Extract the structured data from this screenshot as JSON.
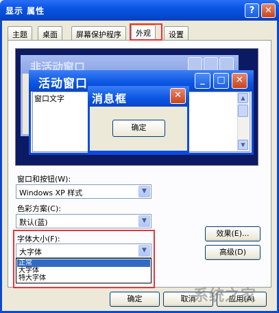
{
  "window": {
    "title": "显示 属性",
    "help_label": "?",
    "close_label": "✕"
  },
  "tabs": [
    {
      "label": "主题"
    },
    {
      "label": "桌面"
    },
    {
      "label": "屏幕保护程序"
    },
    {
      "label": "外观",
      "active": true
    },
    {
      "label": "设置"
    }
  ],
  "preview": {
    "inactive_title": "非活动窗口",
    "active_title": "活动窗口",
    "window_text": "窗口文字",
    "message_title": "消息框",
    "message_ok": "确定"
  },
  "fields": {
    "windows_buttons_label": "窗口和按钮(W):",
    "windows_buttons_value": "Windows XP 样式",
    "color_scheme_label": "色彩方案(C):",
    "color_scheme_value": "默认(蓝)",
    "font_size_label": "字体大小(F):",
    "font_size_value": "大字体",
    "font_size_options": [
      "正常",
      "大字体",
      "特大字体"
    ],
    "font_size_selected": "正常"
  },
  "buttons": {
    "effects": "效果(E)...",
    "advanced": "高级(D)",
    "ok": "确定",
    "cancel": "取消",
    "apply": "应用(A)"
  },
  "watermark": "系统之家",
  "colors": {
    "titlebar": "#0a55e3",
    "highlight_box": "#e8343a",
    "preview_bg": "#0b1a63",
    "selection": "#316ac5"
  }
}
